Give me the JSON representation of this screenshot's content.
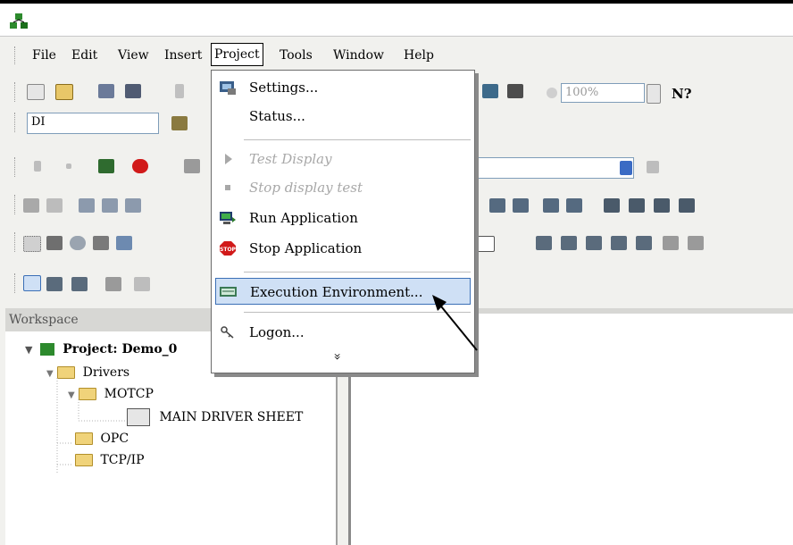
{
  "menubar": {
    "items": [
      "File",
      "Edit",
      "View",
      "Insert",
      "Project",
      "Tools",
      "Window",
      "Help"
    ],
    "active": "Project"
  },
  "toolbar": {
    "tag_combo": "DI",
    "zoom_combo": "100%",
    "help_symbol": "N?"
  },
  "project_menu": {
    "items": [
      {
        "label": "Settings...",
        "icon": "settings-icon",
        "enabled": true
      },
      {
        "label": "Status...",
        "icon": "",
        "enabled": true
      },
      {
        "label": "Test Display",
        "icon": "play-icon",
        "enabled": false
      },
      {
        "label": "Stop display test",
        "icon": "stop-square-icon",
        "enabled": false
      },
      {
        "label": "Run Application",
        "icon": "run-app-icon",
        "enabled": true
      },
      {
        "label": "Stop Application",
        "icon": "stop-sign-icon",
        "enabled": true
      },
      {
        "label": "Execution Environment...",
        "icon": "execution-env-icon",
        "enabled": true,
        "highlighted": true
      },
      {
        "label": "Logon...",
        "icon": "logon-icon",
        "enabled": true
      }
    ],
    "more_glyph": "»"
  },
  "workspace": {
    "title": "Workspace",
    "tree": {
      "project": "Project: Demo_0",
      "drivers": "Drivers",
      "motcp": "MOTCP",
      "main_driver_sheet": "MAIN DRIVER SHEET",
      "opc": "OPC",
      "tcpip": "TCP/IP"
    }
  },
  "colors": {
    "highlight_bg": "#cfe0f5",
    "highlight_border": "#3b6fb6",
    "menu_border": "#6c6c6c",
    "chrome_bg": "#f1f1ee"
  }
}
